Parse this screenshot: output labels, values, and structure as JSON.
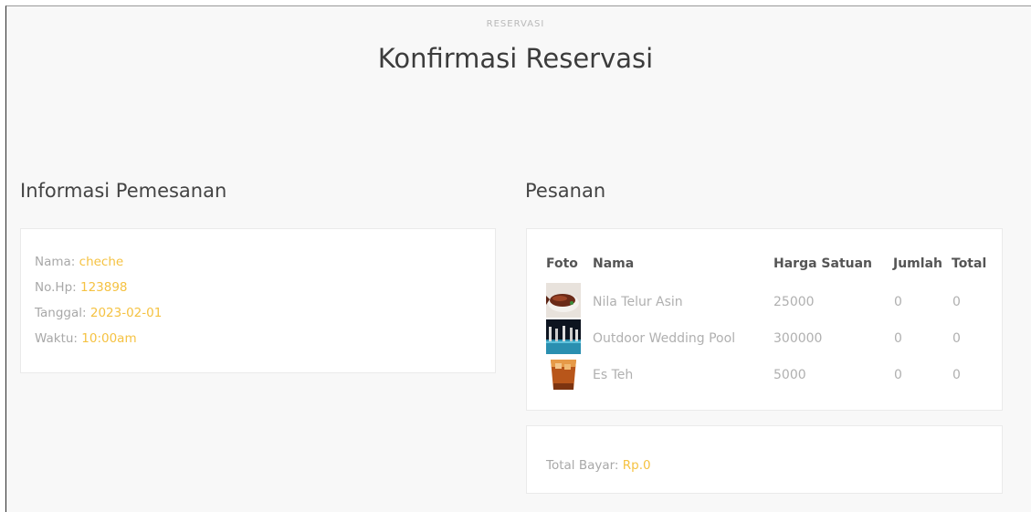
{
  "header": {
    "eyebrow": "RESERVASI",
    "title": "Konfirmasi Reservasi"
  },
  "booking_info": {
    "heading": "Informasi Pemesanan",
    "name_label": "Nama:",
    "name_value": "cheche",
    "phone_label": "No.Hp:",
    "phone_value": "123898",
    "date_label": "Tanggal:",
    "date_value": "2023-02-01",
    "time_label": "Waktu:",
    "time_value": "10:00am"
  },
  "orders": {
    "heading": "Pesanan",
    "columns": {
      "photo": "Foto",
      "name": "Nama",
      "unit_price": "Harga Satuan",
      "qty": "Jumlah",
      "total": "Total"
    },
    "rows": [
      {
        "photo": "grilled-fish-icon",
        "name": "Nila Telur Asin",
        "unit_price": "25000",
        "qty": "0",
        "total": "0"
      },
      {
        "photo": "pool-venue-icon",
        "name": "Outdoor Wedding Pool",
        "unit_price": "300000",
        "qty": "0",
        "total": "0"
      },
      {
        "photo": "iced-tea-icon",
        "name": "Es Teh",
        "unit_price": "5000",
        "qty": "0",
        "total": "0"
      }
    ]
  },
  "payment": {
    "label": "Total Bayar:",
    "value": "Rp.0"
  },
  "colors": {
    "accent": "#f5c242",
    "muted_text": "#a8a8a8",
    "heading_text": "#444444",
    "page_bg": "#f8f8f8",
    "card_bg": "#ffffff"
  }
}
